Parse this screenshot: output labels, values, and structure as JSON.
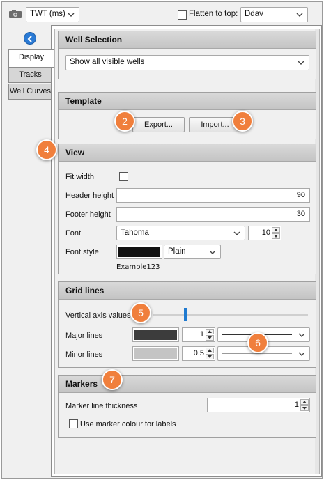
{
  "toolbar": {
    "time_domain": "TWT (ms)",
    "flatten_label": "Flatten to top:",
    "flatten_checked": false,
    "flatten_value": "Ddav"
  },
  "tabs": [
    {
      "label": "Display",
      "active": true
    },
    {
      "label": "Tracks",
      "active": false
    },
    {
      "label": "Well Curves",
      "active": false
    }
  ],
  "well_selection": {
    "title": "Well Selection",
    "value": "Show all visible wells"
  },
  "template": {
    "title": "Template",
    "export_label": "Export...",
    "import_label": "Import..."
  },
  "view": {
    "title": "View",
    "fit_width_label": "Fit width",
    "fit_width_checked": false,
    "header_height_label": "Header height",
    "header_height_value": "90",
    "footer_height_label": "Footer height",
    "footer_height_value": "30",
    "font_label": "Font",
    "font_value": "Tahoma",
    "font_size_value": "10",
    "font_style_label": "Font style",
    "font_color": "#111111",
    "font_style_value": "Plain",
    "example_text": "Example123"
  },
  "grid_lines": {
    "title": "Grid lines",
    "vertical_axis_label": "Vertical axis values",
    "vertical_axis_level": 0.2,
    "major_lines_label": "Major lines",
    "major_color": "#3c3c3c",
    "major_width_value": "1",
    "minor_lines_label": "Minor lines",
    "minor_color": "#c4c4c4",
    "minor_width_value": "0.5"
  },
  "markers": {
    "title": "Markers",
    "thickness_label": "Marker line thickness",
    "thickness_value": "1",
    "use_colour_label": "Use marker colour for labels",
    "use_colour_checked": false
  },
  "callouts": [
    "2",
    "3",
    "4",
    "5",
    "6",
    "7"
  ],
  "colors": {
    "accent_blue": "#1f7ad0",
    "callout_orange": "#f07f3c",
    "section_header": "#c9c9c9"
  }
}
